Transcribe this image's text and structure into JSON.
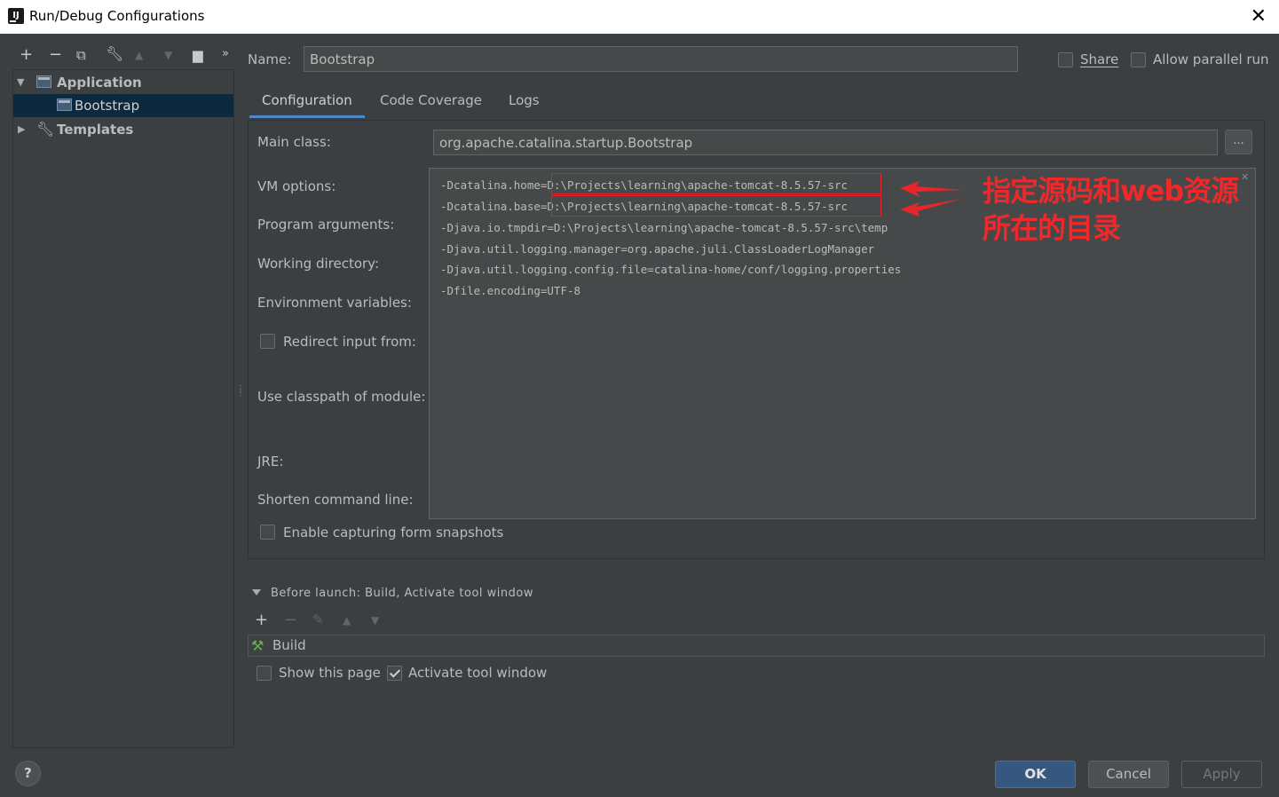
{
  "window": {
    "title": "Run/Debug Configurations",
    "app_icon": "IJ"
  },
  "left": {
    "toolbar_icons": [
      "plus-icon",
      "minus-icon",
      "copy-icon",
      "wrench-icon",
      "arrow-up-icon",
      "arrow-down-icon",
      "folder-add-icon",
      "more-icon"
    ],
    "tree": {
      "application": "Application",
      "bootstrap": "Bootstrap",
      "templates": "Templates"
    }
  },
  "header": {
    "name_label": "Name:",
    "name_value": "Bootstrap",
    "share_label": "Share",
    "parallel_label": "Allow parallel run"
  },
  "tabs": [
    {
      "label": "Configuration",
      "active": true
    },
    {
      "label": "Code Coverage",
      "active": false
    },
    {
      "label": "Logs",
      "active": false
    }
  ],
  "config": {
    "main_class_label": "Main class:",
    "main_class_value": "org.apache.catalina.startup.Bootstrap",
    "browse_label": "...",
    "vm_options_label": "VM options:",
    "program_args_label": "Program arguments:",
    "working_dir_label": "Working directory:",
    "env_vars_label": "Environment variables:",
    "redirect_label": "Redirect input from:",
    "classpath_label": "Use classpath of module:",
    "jre_label": "JRE:",
    "shorten_label": "Shorten command line:",
    "capture_label": "Enable capturing form snapshots",
    "vm_lines": [
      "-Dcatalina.home=D:\\Projects\\learning\\apache-tomcat-8.5.57-src",
      "-Dcatalina.base=D:\\Projects\\learning\\apache-tomcat-8.5.57-src",
      "-Djava.io.tmpdir=D:\\Projects\\learning\\apache-tomcat-8.5.57-src\\temp",
      "-Djava.util.logging.manager=org.apache.juli.ClassLoaderLogManager",
      "-Djava.util.logging.config.file=catalina-home/conf/logging.properties",
      "-Dfile.encoding=UTF-8"
    ],
    "annotation_line1": "指定源码和web资源",
    "annotation_line2": "所在的目录"
  },
  "before_launch": {
    "title": "Before launch: Build, Activate tool window",
    "build_label": "Build",
    "show_page_label": "Show this page",
    "activate_label": "Activate tool window"
  },
  "buttons": {
    "help": "?",
    "ok": "OK",
    "cancel": "Cancel",
    "apply": "Apply"
  },
  "colors": {
    "background": "#3c3f41",
    "selected_row": "#0d293e",
    "accent": "#4a88c7",
    "ok_button": "#365880",
    "annotation_red": "#e0232b"
  }
}
